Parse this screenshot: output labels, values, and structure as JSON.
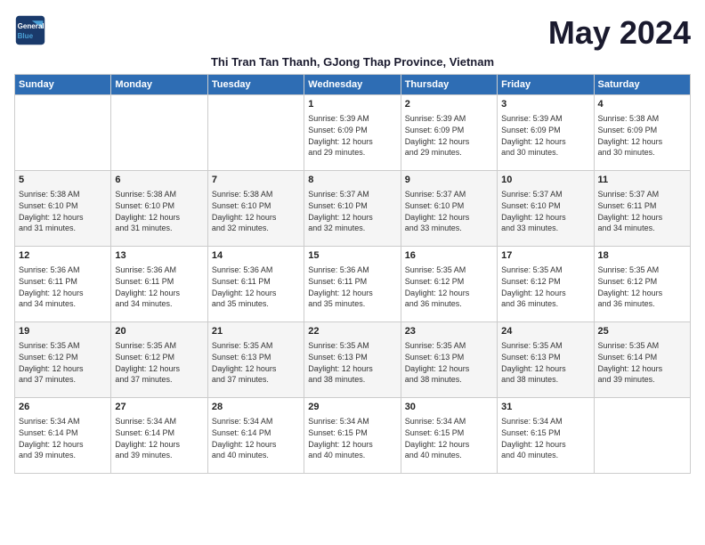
{
  "header": {
    "logo_line1": "General",
    "logo_line2": "Blue",
    "title": "May 2024",
    "subtitle": "Thi Tran Tan Thanh, GJong Thap Province, Vietnam"
  },
  "days_of_week": [
    "Sunday",
    "Monday",
    "Tuesday",
    "Wednesday",
    "Thursday",
    "Friday",
    "Saturday"
  ],
  "weeks": [
    [
      {
        "day": "",
        "info": ""
      },
      {
        "day": "",
        "info": ""
      },
      {
        "day": "",
        "info": ""
      },
      {
        "day": "1",
        "info": "Sunrise: 5:39 AM\nSunset: 6:09 PM\nDaylight: 12 hours\nand 29 minutes."
      },
      {
        "day": "2",
        "info": "Sunrise: 5:39 AM\nSunset: 6:09 PM\nDaylight: 12 hours\nand 29 minutes."
      },
      {
        "day": "3",
        "info": "Sunrise: 5:39 AM\nSunset: 6:09 PM\nDaylight: 12 hours\nand 30 minutes."
      },
      {
        "day": "4",
        "info": "Sunrise: 5:38 AM\nSunset: 6:09 PM\nDaylight: 12 hours\nand 30 minutes."
      }
    ],
    [
      {
        "day": "5",
        "info": "Sunrise: 5:38 AM\nSunset: 6:10 PM\nDaylight: 12 hours\nand 31 minutes."
      },
      {
        "day": "6",
        "info": "Sunrise: 5:38 AM\nSunset: 6:10 PM\nDaylight: 12 hours\nand 31 minutes."
      },
      {
        "day": "7",
        "info": "Sunrise: 5:38 AM\nSunset: 6:10 PM\nDaylight: 12 hours\nand 32 minutes."
      },
      {
        "day": "8",
        "info": "Sunrise: 5:37 AM\nSunset: 6:10 PM\nDaylight: 12 hours\nand 32 minutes."
      },
      {
        "day": "9",
        "info": "Sunrise: 5:37 AM\nSunset: 6:10 PM\nDaylight: 12 hours\nand 33 minutes."
      },
      {
        "day": "10",
        "info": "Sunrise: 5:37 AM\nSunset: 6:10 PM\nDaylight: 12 hours\nand 33 minutes."
      },
      {
        "day": "11",
        "info": "Sunrise: 5:37 AM\nSunset: 6:11 PM\nDaylight: 12 hours\nand 34 minutes."
      }
    ],
    [
      {
        "day": "12",
        "info": "Sunrise: 5:36 AM\nSunset: 6:11 PM\nDaylight: 12 hours\nand 34 minutes."
      },
      {
        "day": "13",
        "info": "Sunrise: 5:36 AM\nSunset: 6:11 PM\nDaylight: 12 hours\nand 34 minutes."
      },
      {
        "day": "14",
        "info": "Sunrise: 5:36 AM\nSunset: 6:11 PM\nDaylight: 12 hours\nand 35 minutes."
      },
      {
        "day": "15",
        "info": "Sunrise: 5:36 AM\nSunset: 6:11 PM\nDaylight: 12 hours\nand 35 minutes."
      },
      {
        "day": "16",
        "info": "Sunrise: 5:35 AM\nSunset: 6:12 PM\nDaylight: 12 hours\nand 36 minutes."
      },
      {
        "day": "17",
        "info": "Sunrise: 5:35 AM\nSunset: 6:12 PM\nDaylight: 12 hours\nand 36 minutes."
      },
      {
        "day": "18",
        "info": "Sunrise: 5:35 AM\nSunset: 6:12 PM\nDaylight: 12 hours\nand 36 minutes."
      }
    ],
    [
      {
        "day": "19",
        "info": "Sunrise: 5:35 AM\nSunset: 6:12 PM\nDaylight: 12 hours\nand 37 minutes."
      },
      {
        "day": "20",
        "info": "Sunrise: 5:35 AM\nSunset: 6:12 PM\nDaylight: 12 hours\nand 37 minutes."
      },
      {
        "day": "21",
        "info": "Sunrise: 5:35 AM\nSunset: 6:13 PM\nDaylight: 12 hours\nand 37 minutes."
      },
      {
        "day": "22",
        "info": "Sunrise: 5:35 AM\nSunset: 6:13 PM\nDaylight: 12 hours\nand 38 minutes."
      },
      {
        "day": "23",
        "info": "Sunrise: 5:35 AM\nSunset: 6:13 PM\nDaylight: 12 hours\nand 38 minutes."
      },
      {
        "day": "24",
        "info": "Sunrise: 5:35 AM\nSunset: 6:13 PM\nDaylight: 12 hours\nand 38 minutes."
      },
      {
        "day": "25",
        "info": "Sunrise: 5:35 AM\nSunset: 6:14 PM\nDaylight: 12 hours\nand 39 minutes."
      }
    ],
    [
      {
        "day": "26",
        "info": "Sunrise: 5:34 AM\nSunset: 6:14 PM\nDaylight: 12 hours\nand 39 minutes."
      },
      {
        "day": "27",
        "info": "Sunrise: 5:34 AM\nSunset: 6:14 PM\nDaylight: 12 hours\nand 39 minutes."
      },
      {
        "day": "28",
        "info": "Sunrise: 5:34 AM\nSunset: 6:14 PM\nDaylight: 12 hours\nand 40 minutes."
      },
      {
        "day": "29",
        "info": "Sunrise: 5:34 AM\nSunset: 6:15 PM\nDaylight: 12 hours\nand 40 minutes."
      },
      {
        "day": "30",
        "info": "Sunrise: 5:34 AM\nSunset: 6:15 PM\nDaylight: 12 hours\nand 40 minutes."
      },
      {
        "day": "31",
        "info": "Sunrise: 5:34 AM\nSunset: 6:15 PM\nDaylight: 12 hours\nand 40 minutes."
      },
      {
        "day": "",
        "info": ""
      }
    ]
  ]
}
